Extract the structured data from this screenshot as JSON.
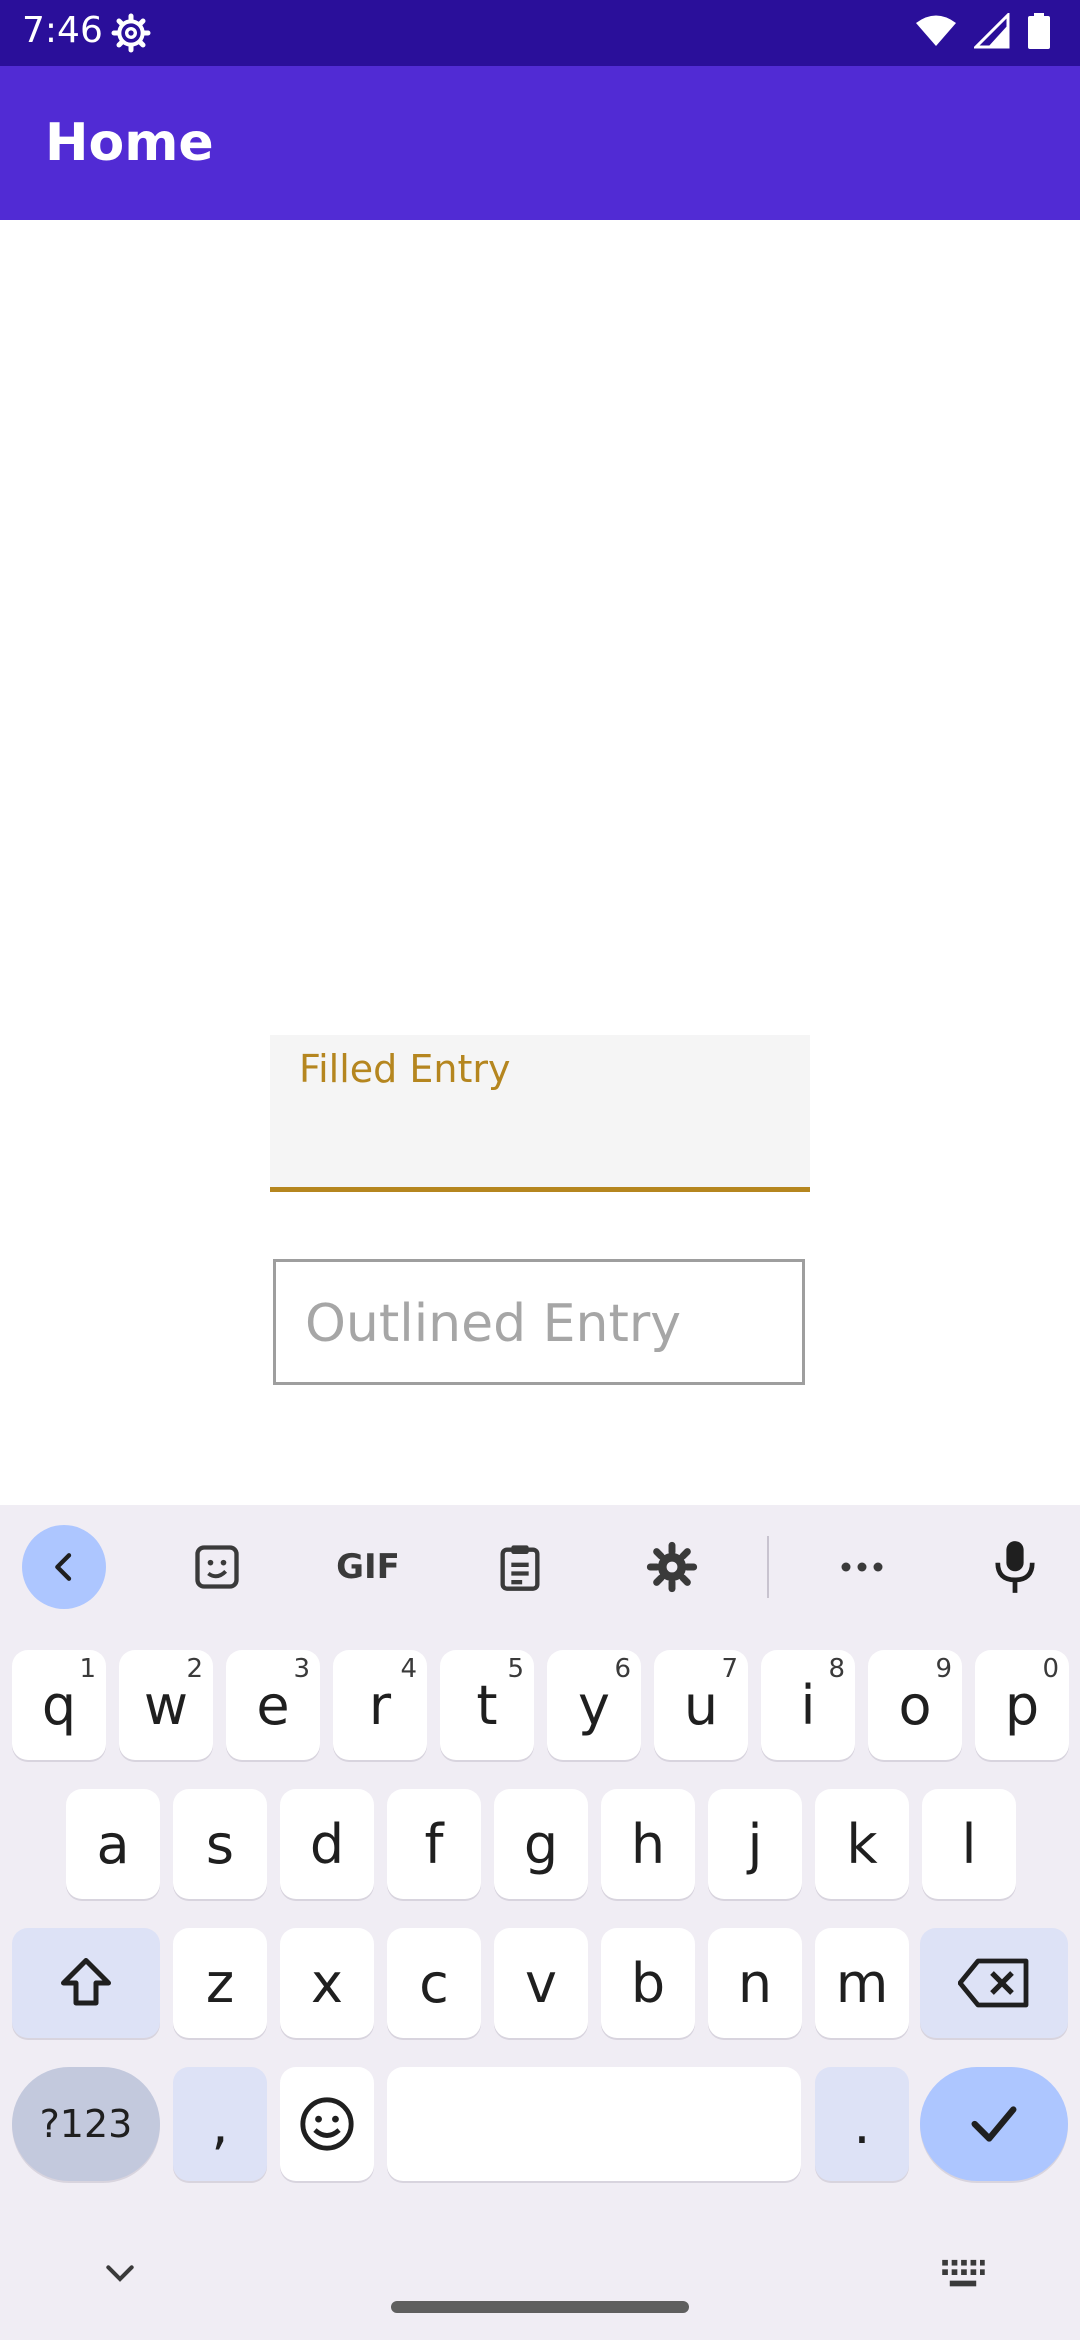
{
  "status_bar": {
    "time": "7:46",
    "icons": [
      "settings-gear-icon",
      "wifi-icon",
      "signal-icon",
      "battery-icon"
    ]
  },
  "app_bar": {
    "title": "Home"
  },
  "filled_entry": {
    "label": "Filled Entry",
    "value": "",
    "accent": "#b5861f"
  },
  "outlined_entry": {
    "placeholder": "Outlined Entry",
    "value": ""
  },
  "keyboard": {
    "toolbar": [
      "back-icon",
      "sticker-icon",
      "gif-icon",
      "clipboard-icon",
      "settings-icon",
      "more-icon",
      "microphone-icon"
    ],
    "gif_label": "GIF",
    "row1": [
      {
        "k": "q",
        "h": "1"
      },
      {
        "k": "w",
        "h": "2"
      },
      {
        "k": "e",
        "h": "3"
      },
      {
        "k": "r",
        "h": "4"
      },
      {
        "k": "t",
        "h": "5"
      },
      {
        "k": "y",
        "h": "6"
      },
      {
        "k": "u",
        "h": "7"
      },
      {
        "k": "i",
        "h": "8"
      },
      {
        "k": "o",
        "h": "9"
      },
      {
        "k": "p",
        "h": "0"
      }
    ],
    "row2": [
      "a",
      "s",
      "d",
      "f",
      "g",
      "h",
      "j",
      "k",
      "l"
    ],
    "row3": [
      "z",
      "x",
      "c",
      "v",
      "b",
      "n",
      "m"
    ],
    "symbols_label": "?123",
    "comma_label": ",",
    "period_label": ".",
    "colors": {
      "accent": "#adc6ff",
      "modifier": "#dde2f6",
      "background": "#f0edf4"
    }
  }
}
